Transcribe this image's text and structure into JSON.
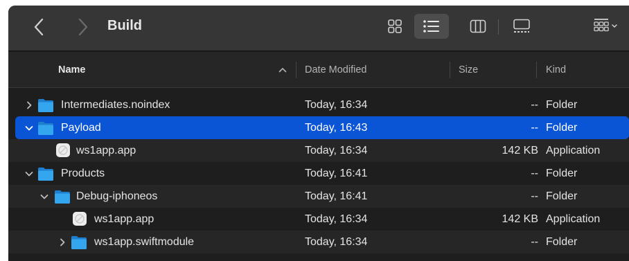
{
  "window": {
    "title": "Build"
  },
  "toolbar": {
    "icons": [
      "chevron-left-icon",
      "chevron-right-icon",
      "icon-view-icon",
      "list-view-icon",
      "column-view-icon",
      "gallery-view-icon",
      "group-icon"
    ],
    "active_view": "list"
  },
  "columns": {
    "name": "Name",
    "date": "Date Modified",
    "size": "Size",
    "kind": "Kind"
  },
  "rows": [
    {
      "name": "Intermediates.noindex",
      "date": "Today, 16:34",
      "size": "--",
      "kind": "Folder",
      "type": "folder",
      "level": 0,
      "disclosure": "collapsed",
      "selected": false
    },
    {
      "name": "Payload",
      "date": "Today, 16:43",
      "size": "--",
      "kind": "Folder",
      "type": "folder",
      "level": 0,
      "disclosure": "expanded",
      "selected": true
    },
    {
      "name": "ws1app.app",
      "date": "Today, 16:34",
      "size": "142 KB",
      "kind": "Application",
      "type": "app",
      "level": 1,
      "disclosure": "none",
      "selected": false
    },
    {
      "name": "Products",
      "date": "Today, 16:41",
      "size": "--",
      "kind": "Folder",
      "type": "folder",
      "level": 0,
      "disclosure": "expanded",
      "selected": false
    },
    {
      "name": "Debug-iphoneos",
      "date": "Today, 16:41",
      "size": "--",
      "kind": "Folder",
      "type": "folder",
      "level": 1,
      "disclosure": "expanded",
      "selected": false
    },
    {
      "name": "ws1app.app",
      "date": "Today, 16:34",
      "size": "142 KB",
      "kind": "Application",
      "type": "app",
      "level": 2,
      "disclosure": "none",
      "selected": false
    },
    {
      "name": "ws1app.swiftmodule",
      "date": "Today, 16:34",
      "size": "--",
      "kind": "Folder",
      "type": "folder",
      "level": 2,
      "disclosure": "collapsed",
      "selected": false
    }
  ],
  "colors": {
    "selection": "#0a55d6",
    "folder": "#2fa0ec",
    "text": "#e4e4e4"
  }
}
